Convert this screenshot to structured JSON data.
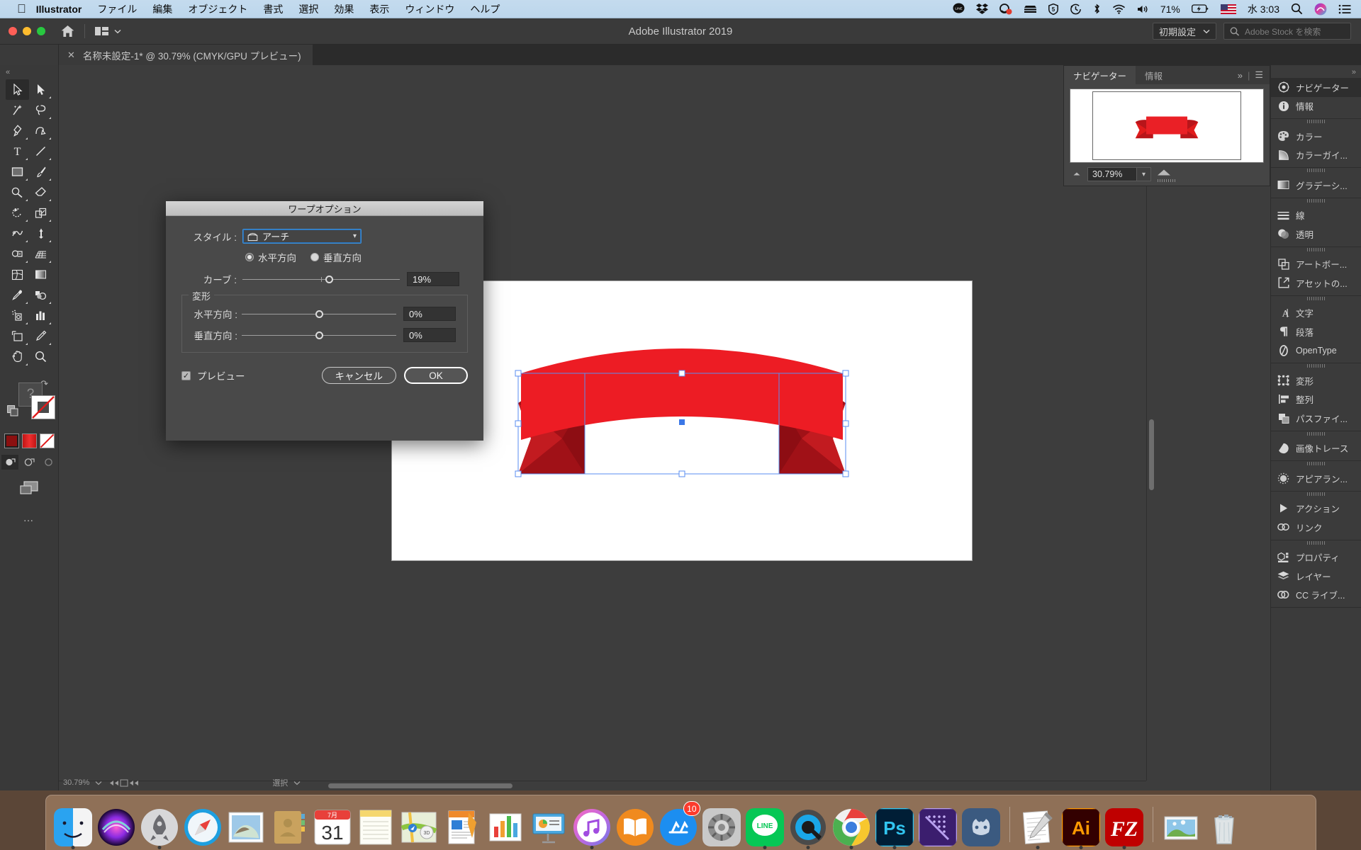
{
  "macbar": {
    "apple_icon": "apple-icon",
    "menus": [
      {
        "label": "Illustrator",
        "bold": true
      },
      {
        "label": "ファイル"
      },
      {
        "label": "編集"
      },
      {
        "label": "オブジェクト"
      },
      {
        "label": "書式"
      },
      {
        "label": "選択"
      },
      {
        "label": "効果"
      },
      {
        "label": "表示"
      },
      {
        "label": "ウィンドウ"
      },
      {
        "label": "ヘルプ"
      }
    ],
    "status": {
      "battery": "71%",
      "day_time": "水 3:03",
      "icons": [
        "line-icon",
        "dropbox-icon",
        "cleanmymac-icon",
        "nas-icon",
        "sophos-icon",
        "timemachine-icon",
        "bluetooth-icon",
        "wifi-icon",
        "volume-icon",
        "battery-icon",
        "flag-us-icon",
        "spotlight-search-icon",
        "siri-icon",
        "control-center-icon"
      ]
    }
  },
  "titlebar": {
    "window_title": "Adobe Illustrator 2019",
    "home_icon": "home-icon",
    "arrange_icon": "arrange-documents-icon",
    "workspace": "初期設定",
    "stock_placeholder": "Adobe Stock を検索"
  },
  "tabs": [
    {
      "label": "名称未設定-1* @ 30.79% (CMYK/GPU プレビュー)",
      "close_icon": "close-icon",
      "active": true
    }
  ],
  "toolbar": {
    "collapse_icon": "collapse-left-icon",
    "tools": [
      {
        "name": "selection-tool",
        "selected": true
      },
      {
        "name": "direct-selection-tool"
      },
      {
        "name": "magic-wand-tool"
      },
      {
        "name": "lasso-tool"
      },
      {
        "name": "pen-tool"
      },
      {
        "name": "curvature-tool"
      },
      {
        "name": "type-tool"
      },
      {
        "name": "line-segment-tool"
      },
      {
        "name": "rectangle-tool"
      },
      {
        "name": "paintbrush-tool"
      },
      {
        "name": "shaper-tool"
      },
      {
        "name": "eraser-tool"
      },
      {
        "name": "rotate-tool"
      },
      {
        "name": "scale-tool"
      },
      {
        "name": "width-tool"
      },
      {
        "name": "free-transform-tool"
      },
      {
        "name": "shape-builder-tool"
      },
      {
        "name": "perspective-grid-tool"
      },
      {
        "name": "mesh-tool"
      },
      {
        "name": "gradient-tool"
      },
      {
        "name": "eyedropper-tool"
      },
      {
        "name": "blend-tool"
      },
      {
        "name": "symbol-sprayer-tool"
      },
      {
        "name": "column-graph-tool"
      },
      {
        "name": "artboard-tool"
      },
      {
        "name": "slice-tool"
      },
      {
        "name": "hand-tool"
      },
      {
        "name": "zoom-tool"
      }
    ],
    "fill_color": "#ffffff",
    "stroke_color": "#ffffff",
    "mini_swatches": [
      {
        "name": "color-swatch",
        "color": "#8b1010",
        "selected": true
      },
      {
        "name": "gradient-swatch",
        "color": "#e01b1b"
      },
      {
        "name": "none-swatch",
        "color": "#ffffff"
      }
    ],
    "draw_modes": [
      {
        "name": "draw-normal-mode",
        "selected": true
      },
      {
        "name": "draw-behind-mode"
      },
      {
        "name": "draw-inside-mode"
      }
    ],
    "screen_mode": "change-screen-mode-icon",
    "more_tools": "edit-toolbar-icon"
  },
  "canvas": {
    "zoom_status": "30.79%",
    "artwork_name": "red-ribbon-banner-artwork",
    "selection": {
      "bounding_box_visible": true,
      "handles": 8
    },
    "ribbon_color": "#ed1c24",
    "ribbon_shadow_color": "#9c1016"
  },
  "navigator": {
    "tabs": [
      {
        "label": "ナビゲーター",
        "active": true
      },
      {
        "label": "情報",
        "active": false
      }
    ],
    "collapse_icon": "double-chevron-right-icon",
    "menu_icon": "panel-menu-icon",
    "zoom_value": "30.79%",
    "zoom_out_icon": "zoom-out-icon",
    "zoom_in_icon": "zoom-in-icon",
    "chevron_icon": "chevron-down-icon"
  },
  "panel_rail": {
    "collapse_icon": "collapse-right-icon",
    "groups": [
      {
        "items": [
          {
            "label": "ナビゲーター",
            "icon": "navigator-icon",
            "active": true
          },
          {
            "label": "情報",
            "icon": "info-icon",
            "active": false
          }
        ]
      },
      {
        "items": [
          {
            "label": "カラー",
            "icon": "color-icon"
          },
          {
            "label": "カラーガイ...",
            "icon": "color-guide-icon"
          }
        ]
      },
      {
        "items": [
          {
            "label": "グラデーシ...",
            "icon": "gradient-icon"
          }
        ]
      },
      {
        "items": [
          {
            "label": "線",
            "icon": "stroke-icon"
          },
          {
            "label": "透明",
            "icon": "transparency-icon"
          }
        ]
      },
      {
        "items": [
          {
            "label": "アートボー...",
            "icon": "artboards-icon"
          },
          {
            "label": "アセットの...",
            "icon": "asset-export-icon"
          }
        ]
      },
      {
        "items": [
          {
            "label": "文字",
            "icon": "character-icon"
          },
          {
            "label": "段落",
            "icon": "paragraph-icon"
          },
          {
            "label": "OpenType",
            "icon": "opentype-icon"
          }
        ]
      },
      {
        "items": [
          {
            "label": "変形",
            "icon": "transform-icon"
          },
          {
            "label": "整列",
            "icon": "align-icon"
          },
          {
            "label": "パスファイ...",
            "icon": "pathfinder-icon"
          }
        ]
      },
      {
        "items": [
          {
            "label": "画像トレース",
            "icon": "image-trace-icon"
          }
        ]
      },
      {
        "items": [
          {
            "label": "アピアラン...",
            "icon": "appearance-icon"
          }
        ]
      },
      {
        "items": [
          {
            "label": "アクション",
            "icon": "actions-icon"
          },
          {
            "label": "リンク",
            "icon": "links-icon"
          }
        ]
      },
      {
        "items": [
          {
            "label": "プロパティ",
            "icon": "properties-icon"
          },
          {
            "label": "レイヤー",
            "icon": "layers-icon"
          },
          {
            "label": "CC ライブ...",
            "icon": "cc-libraries-icon"
          }
        ]
      }
    ]
  },
  "dialog": {
    "title": "ワープオプション",
    "style_label": "スタイル :",
    "style_value": "アーチ",
    "style_icon": "arch-warp-icon",
    "chevron_icon": "chevron-down-icon",
    "orientation": [
      {
        "label": "水平方向",
        "selected": true
      },
      {
        "label": "垂直方向",
        "selected": false
      }
    ],
    "curve_label": "カーブ :",
    "curve_value": "19%",
    "curve_knob_pct": 55,
    "fieldset_legend": "変形",
    "distort": [
      {
        "label": "水平方向 :",
        "value": "0%",
        "knob_pct": 50
      },
      {
        "label": "垂直方向 :",
        "value": "0%",
        "knob_pct": 50
      }
    ],
    "preview_label": "プレビュー",
    "preview_checked": true,
    "cancel_label": "キャンセル",
    "ok_label": "OK"
  },
  "dock": {
    "items": [
      {
        "name": "finder",
        "running": true
      },
      {
        "name": "siri",
        "running": false
      },
      {
        "name": "launchpad",
        "running": true
      },
      {
        "name": "safari",
        "running": false
      },
      {
        "name": "mail",
        "running": false
      },
      {
        "name": "contacts",
        "running": false
      },
      {
        "name": "calendar",
        "running": false,
        "date": "31",
        "month": "7月"
      },
      {
        "name": "notes",
        "running": false
      },
      {
        "name": "maps",
        "running": false
      },
      {
        "name": "pages",
        "running": false
      },
      {
        "name": "numbers",
        "running": false
      },
      {
        "name": "keynote",
        "running": false
      },
      {
        "name": "itunes",
        "running": true
      },
      {
        "name": "ibooks",
        "running": false
      },
      {
        "name": "app-store",
        "running": false,
        "badge": "10"
      },
      {
        "name": "system-preferences",
        "running": false
      },
      {
        "name": "line",
        "running": true
      },
      {
        "name": "quicktime",
        "running": true
      },
      {
        "name": "google-chrome",
        "running": true
      },
      {
        "name": "photoshop",
        "running": true
      },
      {
        "name": "affinity-designer",
        "running": false
      },
      {
        "name": "handbrake",
        "running": false
      },
      {
        "name": "textedit",
        "running": true
      },
      {
        "name": "illustrator",
        "running": true
      },
      {
        "name": "filezilla",
        "running": true
      },
      {
        "name": "photos-stack",
        "running": false
      },
      {
        "name": "trash",
        "running": false
      }
    ]
  }
}
